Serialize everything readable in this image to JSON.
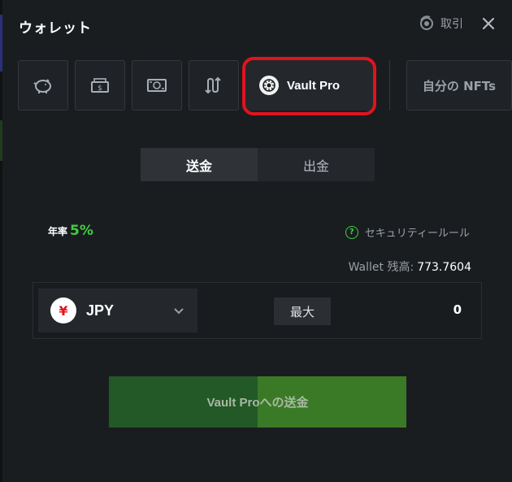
{
  "header": {
    "title": "ウォレット",
    "trade_label": "取引",
    "trade_icon": "coin-swap-icon",
    "close_icon": "close-icon"
  },
  "tabs": {
    "icons": [
      "piggy-bank-icon",
      "cashier-icon",
      "cash-icon",
      "transfer-arrows-icon"
    ],
    "vault_label": "Vault Pro",
    "vault_icon": "vault-icon",
    "nft_label": "自分の NFTs"
  },
  "mode": {
    "deposit_label": "送金",
    "withdraw_label": "出金",
    "active": "送金"
  },
  "apr": {
    "label": "年率",
    "value": "5%"
  },
  "security": {
    "label": "セキュリティールール",
    "icon": "question-icon",
    "icon_glyph": "?"
  },
  "balance": {
    "label": "Wallet 残高:",
    "value": "773.7604"
  },
  "amount": {
    "currency": "JPY",
    "currency_symbol": "¥",
    "max_label": "最大",
    "value": "0"
  },
  "submit_label": "Vault Proへの送金",
  "colors": {
    "accent_green": "#3ecf3e",
    "highlight_red": "#e0141e",
    "button_green": "#2e6b26"
  }
}
